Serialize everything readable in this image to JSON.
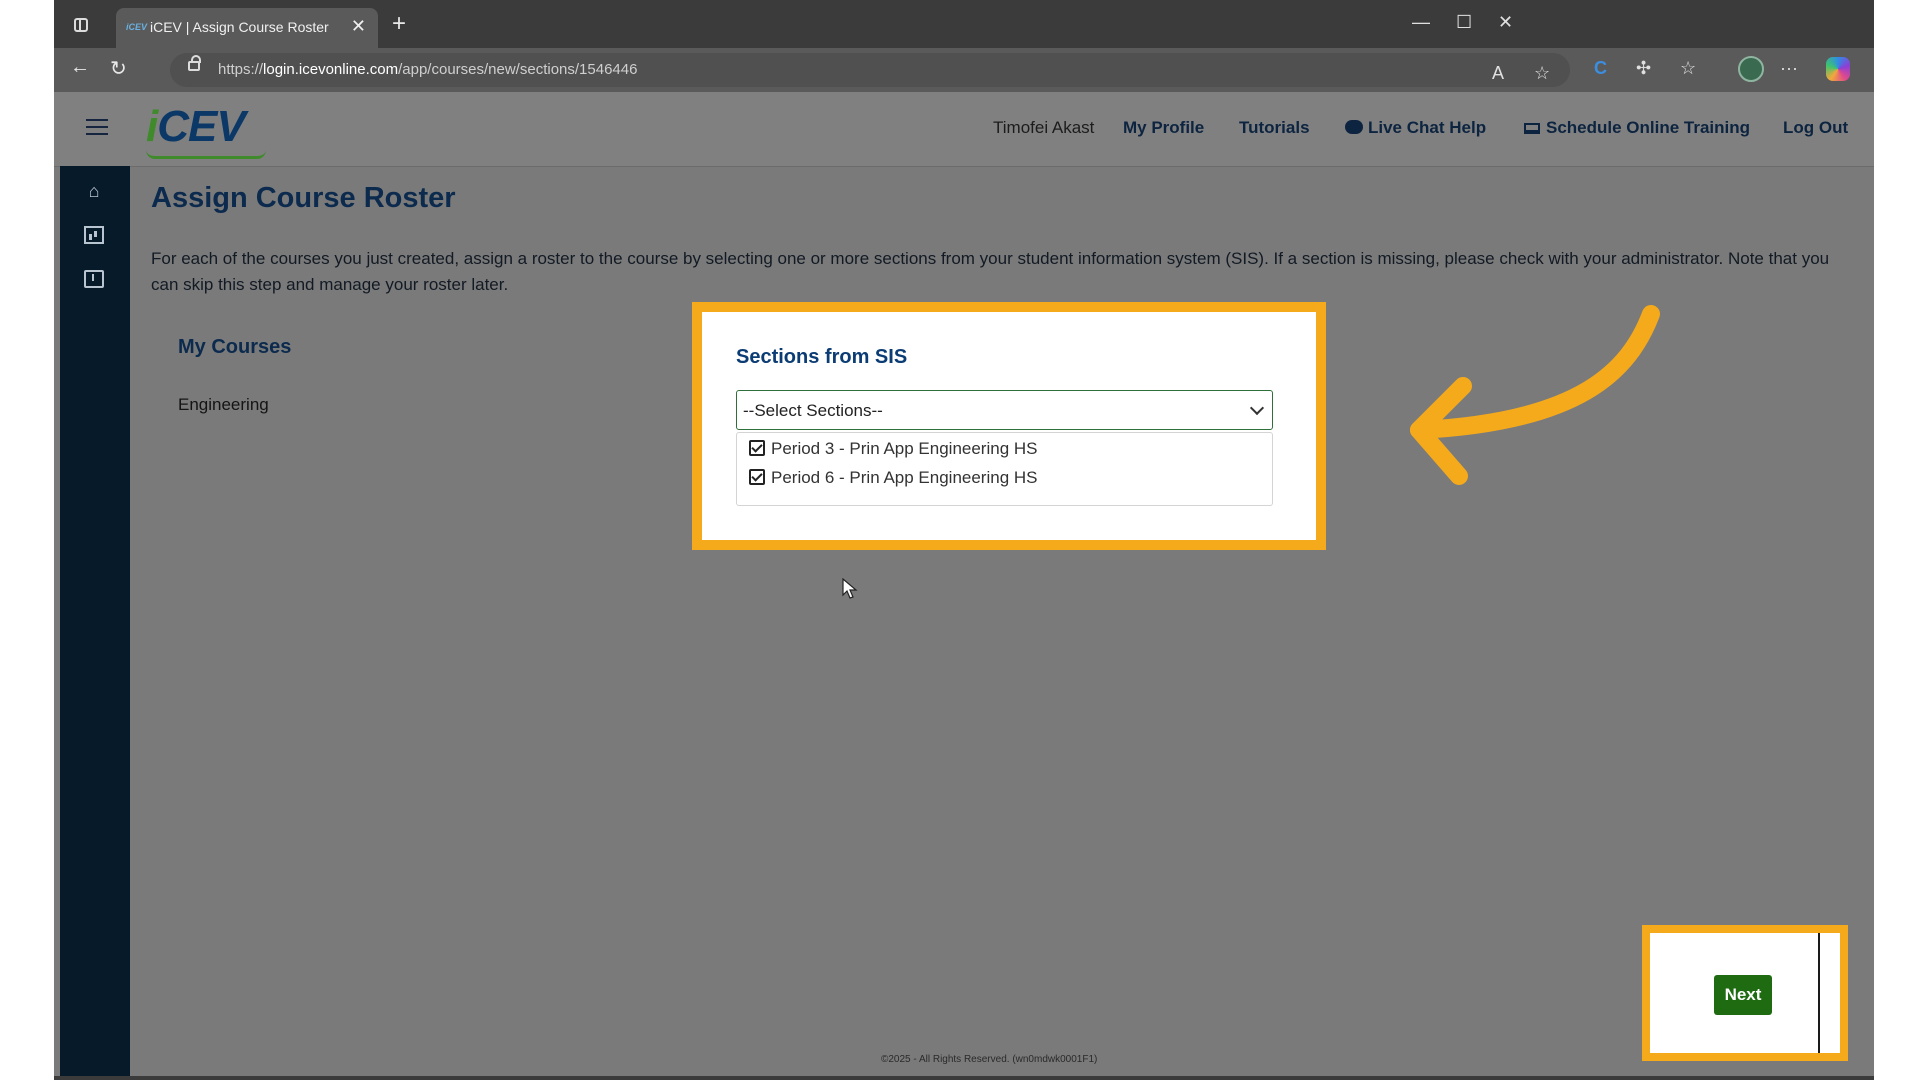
{
  "browser": {
    "tab_title": "iCEV | Assign Course Roster",
    "tab_favicon_text": "iCEV",
    "url_prefix": "https://",
    "url_domain": "login.icevonline.com",
    "url_path": "/app/courses/new/sections/1546446"
  },
  "header": {
    "logo_text": "CEV",
    "logo_accent": "i",
    "user_name": "Timofei Akast",
    "links": {
      "profile": "My Profile",
      "tutorials": "Tutorials",
      "chat": "Live Chat Help",
      "training": "Schedule Online Training",
      "logout": "Log Out"
    }
  },
  "sidebar": {
    "items": [
      {
        "icon": "home-icon"
      },
      {
        "icon": "reports-chart-icon"
      },
      {
        "icon": "inbox-download-icon"
      }
    ]
  },
  "main": {
    "page_title": "Assign Course Roster",
    "intro": "For each of the courses you just created, assign a roster to the course by selecting one or more sections from your student information system (SIS). If a section is missing, please check with your administrator. Note that you can skip this step and manage your roster later.",
    "my_courses_heading": "My Courses",
    "courses": [
      "Engineering"
    ],
    "sis": {
      "heading": "Sections from SIS",
      "select_placeholder": "--Select Sections--",
      "options": [
        {
          "label": "Period 3 - Prin App Engineering HS",
          "checked": true
        },
        {
          "label": "Period 6 - Prin App Engineering HS",
          "checked": true
        }
      ]
    },
    "next_label": "Next",
    "footer": "©2025 - All Rights Reserved. (wn0mdwk0001F1)"
  },
  "colors": {
    "highlight": "#f5aa1c",
    "next_button": "#1f6b12",
    "sidebar": "#061a29",
    "title": "#0b2a4d"
  }
}
